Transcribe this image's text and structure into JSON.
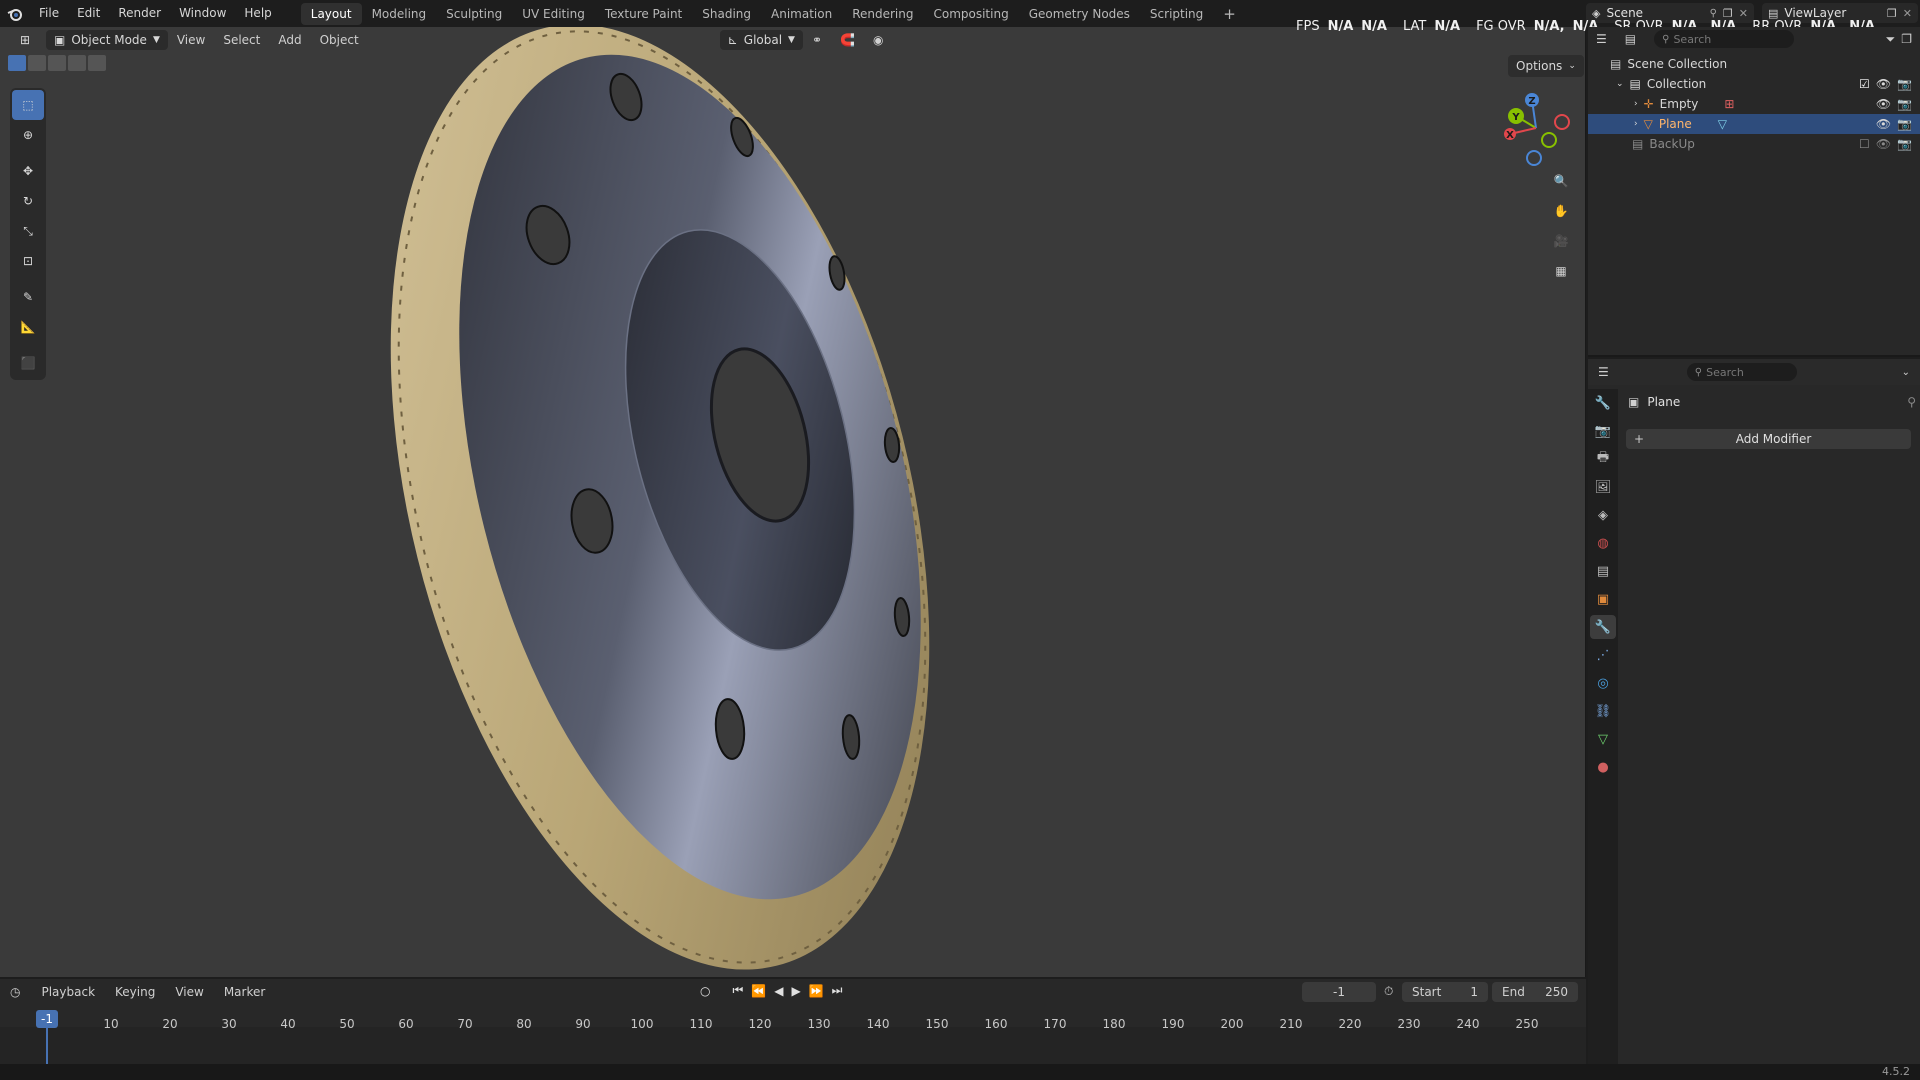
{
  "menu": {
    "items": [
      "File",
      "Edit",
      "Render",
      "Window",
      "Help"
    ]
  },
  "workspaces": {
    "tabs": [
      "Layout",
      "Modeling",
      "Sculpting",
      "UV Editing",
      "Texture Paint",
      "Shading",
      "Animation",
      "Rendering",
      "Compositing",
      "Geometry Nodes",
      "Scripting"
    ],
    "active": "Layout",
    "add_label": "+"
  },
  "scene_selector": {
    "value": "Scene"
  },
  "viewlayer_selector": {
    "value": "ViewLayer"
  },
  "viewport_header": {
    "mode": "Object Mode",
    "menus": [
      "View",
      "Select",
      "Add",
      "Object"
    ],
    "orientation": "Global",
    "options_label": "Options"
  },
  "overlay_stats": {
    "fps_label": "FPS",
    "fps_value": "N/A",
    "fps_value2": "N/A",
    "lat_label": "LAT",
    "lat_value": "N/A",
    "fg_label": "FG OVR",
    "fg_value": "N/A,",
    "fg_value2": "N/A",
    "sr_label": "SR OVR",
    "sr_value": "N/A,",
    "sr_value2": "N/A",
    "rr_label": "RR OVR",
    "rr_value": "N/A,",
    "rr_value2": "N/A"
  },
  "gizmo": {
    "x": "X",
    "y": "Y",
    "z": "Z"
  },
  "outliner": {
    "search_placeholder": "Search",
    "rows": [
      {
        "label": "Scene Collection"
      },
      {
        "label": "Collection"
      },
      {
        "label": "Empty"
      },
      {
        "label": "Plane"
      },
      {
        "label": "BackUp"
      }
    ]
  },
  "properties": {
    "search_placeholder": "Search",
    "object_name": "Plane",
    "add_modifier_label": "Add Modifier"
  },
  "timeline": {
    "menus": [
      "Playback",
      "Keying",
      "View",
      "Marker"
    ],
    "current_frame": "-1",
    "current_frame_marker": "-1",
    "start_label": "Start",
    "start_value": "1",
    "end_label": "End",
    "end_value": "250",
    "ticks": [
      "10",
      "20",
      "30",
      "40",
      "50",
      "60",
      "70",
      "80",
      "90",
      "100",
      "110",
      "120",
      "130",
      "140",
      "150",
      "160",
      "170",
      "180",
      "190",
      "200",
      "210",
      "220",
      "230",
      "240",
      "250"
    ]
  },
  "status": {
    "version": "4.5.2"
  },
  "colors": {
    "accent": "#4772b3",
    "selection": "#2e4c7c",
    "viewport_bg": "#3a3a3a",
    "axis_x": "#e2474c",
    "axis_y": "#88c000",
    "axis_z": "#4a86d6"
  }
}
